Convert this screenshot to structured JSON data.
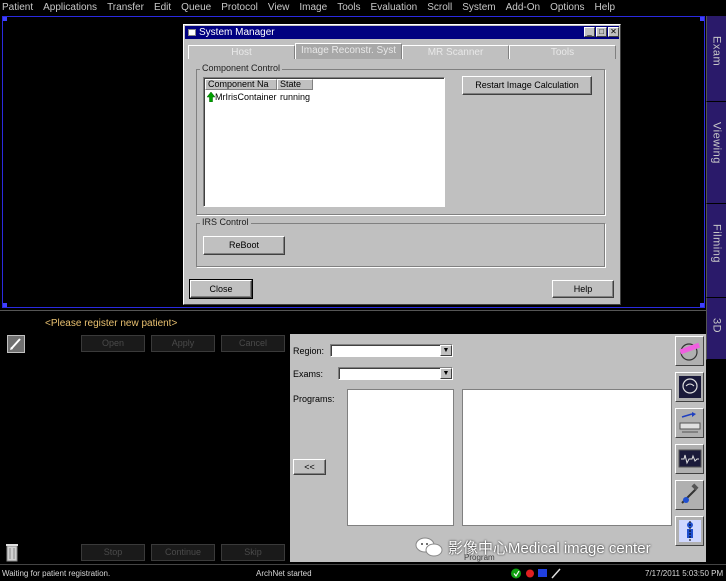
{
  "menu": [
    "Patient",
    "Applications",
    "Transfer",
    "Edit",
    "Queue",
    "Protocol",
    "View",
    "Image",
    "Tools",
    "Evaluation",
    "Scroll",
    "System",
    "Add-On",
    "Options",
    "Help"
  ],
  "side_tabs": [
    "Exam",
    "Viewing",
    "Filming",
    "3D"
  ],
  "system_manager": {
    "title": "System Manager",
    "tabs": [
      "Host",
      "Image Reconstr. Syst",
      "MR Scanner",
      "Tools"
    ],
    "active_tab": "Image Reconstr. Syst",
    "component_control": {
      "legend": "Component Control",
      "columns": [
        "Component Na",
        "State"
      ],
      "rows": [
        {
          "name": "MrIrisContainer",
          "state": "running"
        }
      ],
      "restart_button": "Restart Image Calculation"
    },
    "irs_control": {
      "legend": "IRS Control",
      "reboot_button": "ReBoot"
    },
    "close_button": "Close",
    "help_button": "Help"
  },
  "patient_panel": {
    "notice": "<Please register new patient>",
    "buttons_top": [
      "Open",
      "Apply",
      "Cancel"
    ],
    "buttons_bottom": [
      "Stop",
      "Continue",
      "Skip"
    ]
  },
  "program_panel": {
    "region_label": "Region:",
    "region_value": "",
    "exams_label": "Exams:",
    "exams_value": "",
    "programs_label": "Programs:",
    "move_button": "<<",
    "program_caption": "Program"
  },
  "tool_icons": [
    "head-scan-icon",
    "brain-icon",
    "table-move-icon",
    "monitor-wave-icon",
    "injector-icon",
    "patient-position-icon"
  ],
  "status": {
    "left": "Waiting for patient registration.",
    "center": "ArchNet started",
    "datetime": "7/17/2011 5:03:50 PM"
  },
  "watermark": "影像中心Medical image center",
  "colors": {
    "title_bar": "#000080",
    "dialog_bg": "#c0c0c0",
    "side_tab": "#2a1a6a",
    "notice_text": "#e8c070"
  }
}
